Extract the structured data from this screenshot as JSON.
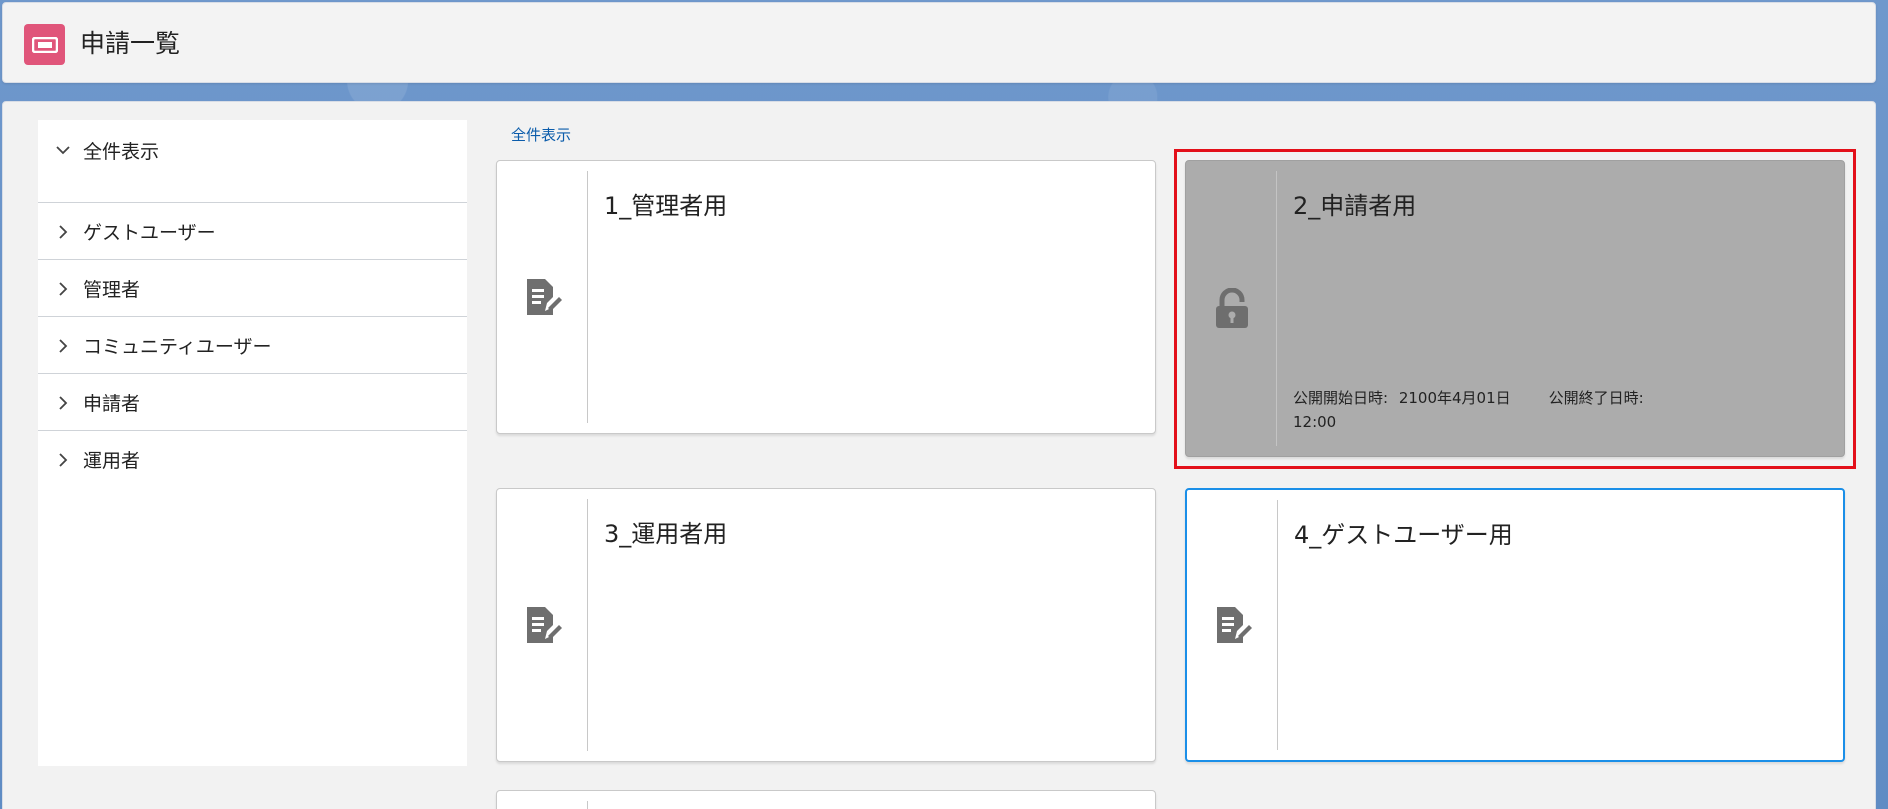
{
  "header": {
    "title": "申請一覧",
    "icon": "ticket-icon",
    "icon_color": "#e0557a"
  },
  "sidebar": {
    "items": [
      {
        "label": "全件表示",
        "expanded": true
      },
      {
        "label": "ゲストユーザー",
        "expanded": false
      },
      {
        "label": "管理者",
        "expanded": false
      },
      {
        "label": "コミュニティユーザー",
        "expanded": false
      },
      {
        "label": "申請者",
        "expanded": false
      },
      {
        "label": "運用者",
        "expanded": false
      }
    ]
  },
  "breadcrumb": {
    "all_link": "全件表示"
  },
  "cards": [
    {
      "title": "1_管理者用",
      "icon": "document-edit-icon",
      "state": "normal"
    },
    {
      "title": "2_申請者用",
      "icon": "lock-icon",
      "state": "locked",
      "meta": {
        "start_label": "公開開始日時:",
        "start_value": "2100年4月01日",
        "start_time": "12:00",
        "end_label": "公開終了日時:"
      }
    },
    {
      "title": "3_運用者用",
      "icon": "document-edit-icon",
      "state": "normal"
    },
    {
      "title": "4_ゲストユーザー用",
      "icon": "document-edit-icon",
      "state": "selected"
    }
  ],
  "colors": {
    "accent_link": "#0b5cab",
    "selected_border": "#1b8fe8",
    "highlight_border": "#e3101a",
    "locked_card": "#acacac"
  }
}
